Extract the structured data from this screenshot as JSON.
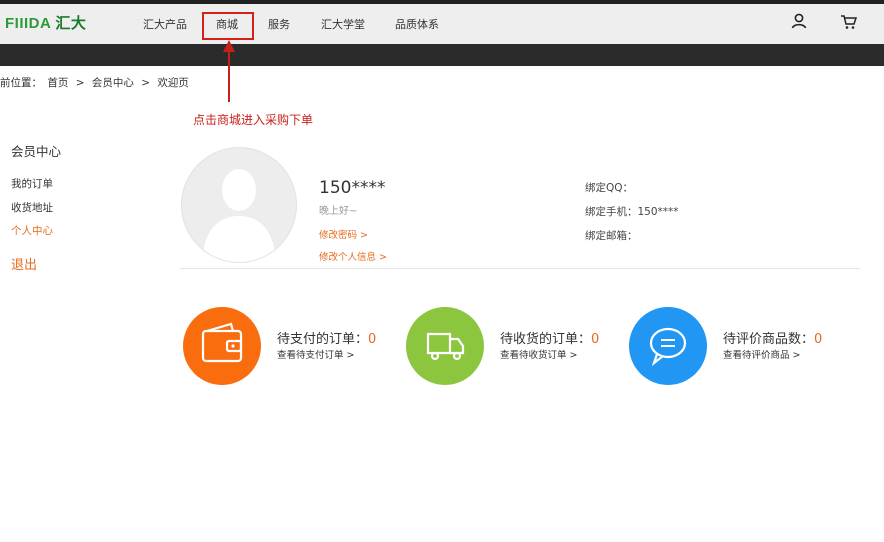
{
  "header": {
    "logo_latin": "FIIIDA",
    "logo_cn": "汇大",
    "nav": [
      "汇大产品",
      "商城",
      "服务",
      "汇大学堂",
      "品质体系"
    ]
  },
  "breadcrumb": {
    "prefix": "前位置：",
    "items": [
      "首页",
      ">",
      "会员中心",
      ">",
      "欢迎页"
    ]
  },
  "annotation": {
    "text": "点击商城进入采购下单",
    "color": "#c81f1a"
  },
  "sidebar": {
    "title": "会员中心",
    "items": [
      "我的订单",
      "收货地址",
      "个人中心"
    ],
    "logout": "退出"
  },
  "profile": {
    "phone": "150****",
    "greeting": "晚上好~",
    "change_password": "修改密码 >",
    "edit_info": "修改个人信息 >",
    "bind_qq": "绑定QQ：",
    "bind_phone": "绑定手机：150****",
    "bind_email": "绑定邮箱："
  },
  "stats": [
    {
      "title": "待支付的订单：",
      "count": "0",
      "link": "查看待支付订单 >",
      "color": "#fa6d0f",
      "icon": "wallet-icon"
    },
    {
      "title": "待收货的订单：",
      "count": "0",
      "link": "查看待收货订单 >",
      "color": "#8cc63f",
      "icon": "truck-icon"
    },
    {
      "title": "待评价商品数：",
      "count": "0",
      "link": "查看待评价商品 >",
      "color": "#2196f3",
      "icon": "chat-bubble-icon"
    }
  ],
  "colors": {
    "accent": "#e96a1c",
    "header_bg": "#eeeeee",
    "band": "#2b2b2b"
  }
}
